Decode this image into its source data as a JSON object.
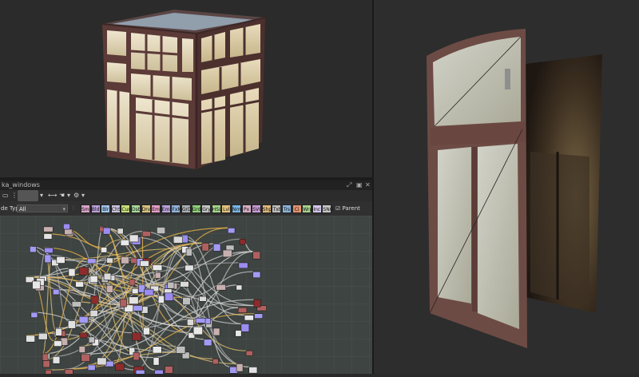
{
  "node_editor": {
    "title": "ka_windows",
    "filter_label": "de Type",
    "filter_value": "All",
    "parent_size_label": "Parent Size:",
    "categories": [
      {
        "label": "Smp",
        "color": "#d9a3c7"
      },
      {
        "label": "Bld",
        "color": "#b9a0d8"
      },
      {
        "label": "Blr",
        "color": "#9fc3e6"
      },
      {
        "label": "ChS",
        "color": "#c9c2d6"
      },
      {
        "label": "Cur",
        "color": "#c5de7a"
      },
      {
        "label": "Dst",
        "color": "#a7d89b"
      },
      {
        "label": "Drv",
        "color": "#d7c27c"
      },
      {
        "label": "Emb",
        "color": "#e2a0c4"
      },
      {
        "label": "Emb",
        "color": "#b7a1d9"
      },
      {
        "label": "FxM",
        "color": "#8fb1d8"
      },
      {
        "label": "GrD",
        "color": "#aab0b2"
      },
      {
        "label": "Grd",
        "color": "#8fd17a"
      },
      {
        "label": "Gry",
        "color": "#c4c4c4"
      },
      {
        "label": "HSL",
        "color": "#a6d58a"
      },
      {
        "label": "Lvl",
        "color": "#e3c27e"
      },
      {
        "label": "Nrm",
        "color": "#7ab6e4"
      },
      {
        "label": "Px",
        "color": "#d6aec4"
      },
      {
        "label": "SVG",
        "color": "#c99bd6"
      },
      {
        "label": "Shp",
        "color": "#e0b979"
      },
      {
        "label": "Txt",
        "color": "#bcbcbc"
      },
      {
        "label": "Trs",
        "color": "#8ab5dc"
      },
      {
        "label": "Ci",
        "color": "#e3916f"
      },
      {
        "label": "Wrp",
        "color": "#a7d48f"
      },
      {
        "label": "Inc",
        "color": "#d3c6ec"
      },
      {
        "label": "SNG",
        "color": "#c8c8c8"
      }
    ]
  }
}
